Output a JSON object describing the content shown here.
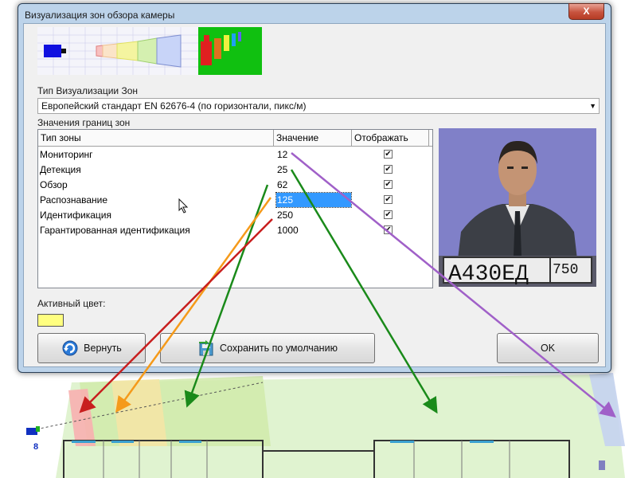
{
  "window": {
    "title": "Визуализация зон обзора камеры",
    "close_label": "X"
  },
  "zone_type": {
    "label": "Тип Визуализации Зон",
    "selected": "Европейский стандарт EN 62676-4 (по горизонтали, пикс/м)"
  },
  "zones": {
    "label": "Значения границ зон",
    "headers": [
      "Тип зоны",
      "Значение",
      "Отображать"
    ],
    "rows": [
      {
        "name": "Мониторинг",
        "value": "12",
        "show": true
      },
      {
        "name": "Детекция",
        "value": "25",
        "show": true
      },
      {
        "name": "Обзор",
        "value": "62",
        "show": true
      },
      {
        "name": "Распознавание",
        "value": "125",
        "show": true,
        "selected": true
      },
      {
        "name": "Идентификация",
        "value": "250",
        "show": true
      },
      {
        "name": "Гарантированная идентификация",
        "value": "1000",
        "show": true
      }
    ]
  },
  "active_color": {
    "label": "Активный цвет:",
    "value": "#ffff80"
  },
  "plate_text": "А430ЕД",
  "plate_region": "750",
  "buttons": {
    "revert": "Вернуть",
    "save_default": "Сохранить по умолчанию",
    "ok": "OK"
  },
  "camera_number": "8",
  "arrow_colors": {
    "monitoring": "#a060c8",
    "detection": "#1a8a1a",
    "overview": "#1a8a1a",
    "recognition": "#f59a1a",
    "identification": "#c81e1e"
  }
}
